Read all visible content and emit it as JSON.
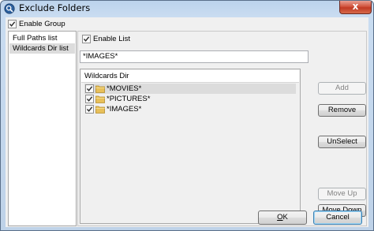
{
  "window": {
    "title": "Exclude Folders",
    "close_glyph": "x",
    "icon": "search-icon"
  },
  "enable_group": {
    "label": "Enable Group",
    "checked": true
  },
  "left_list": {
    "items": [
      {
        "label": "Full Paths list",
        "selected": false
      },
      {
        "label": "Wildcards Dir list",
        "selected": true
      }
    ]
  },
  "enable_list": {
    "label": "Enable List",
    "checked": true
  },
  "wildcard_input": {
    "value": "*IMAGES*"
  },
  "wildcards_group": {
    "header": "Wildcards Dir",
    "rows": [
      {
        "label": "*MOVIES*",
        "checked": true,
        "icon": "folder-icon",
        "highlighted": true
      },
      {
        "label": "*PICTURES*",
        "checked": true,
        "icon": "folder-icon",
        "highlighted": false
      },
      {
        "label": "*IMAGES*",
        "checked": true,
        "icon": "folder-icon",
        "highlighted": false
      }
    ]
  },
  "buttons": {
    "add": {
      "label": "Add",
      "enabled": false
    },
    "remove": {
      "label": "Remove",
      "enabled": true
    },
    "unselect": {
      "label": "UnSelect",
      "enabled": true
    },
    "move_up": {
      "label": "Move Up",
      "enabled": false
    },
    "move_down": {
      "label": "Move Down",
      "enabled": true
    },
    "ok": {
      "label_mnemonic": "O",
      "label_rest": "K"
    },
    "cancel": {
      "label": "Cancel"
    }
  },
  "colors": {
    "title_gradient": "#c9dcf1",
    "close_button": "#c03a24",
    "selection": "#dcdcdc",
    "focus_border": "#3c7fb1"
  }
}
